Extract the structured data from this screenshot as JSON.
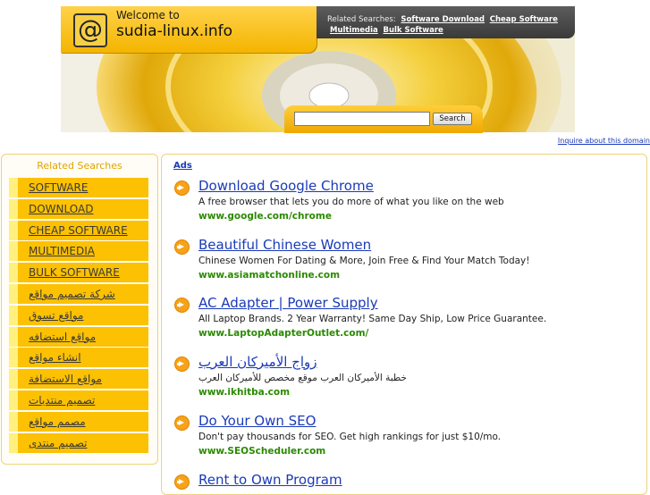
{
  "header": {
    "welcome": "Welcome to",
    "site_name": "sudia-linux.info",
    "related_label": "Related Searches:",
    "related_links": [
      "Software Download",
      "Cheap Software",
      "Multimedia",
      "Bulk Software"
    ],
    "search_button": "Search",
    "search_value": "",
    "inquire": "Inquire about this domain"
  },
  "sidebar": {
    "title": "Related Searches",
    "items": [
      "SOFTWARE",
      "DOWNLOAD",
      "CHEAP SOFTWARE",
      "MULTIMEDIA",
      "BULK SOFTWARE",
      "شركة تصميم مواقع",
      "مواقع تسوق",
      "مواقع استضافه",
      "انشاء مواقع",
      "مواقع الاستضافة",
      "تصميم منتديات",
      "مصمم مواقع",
      "تصميم منتدى"
    ]
  },
  "main": {
    "ads_label": "Ads",
    "ads": [
      {
        "title": "Download Google Chrome",
        "desc": "A free browser that lets you do more of what you like on the web",
        "url": "www.google.com/chrome"
      },
      {
        "title": "Beautiful Chinese Women",
        "desc": "Chinese Women For Dating & More, Join Free & Find Your Match Today!",
        "url": "www.asiamatchonline.com"
      },
      {
        "title": "AC Adapter | Power Supply",
        "desc": "All Laptop Brands. 2 Year Warranty! Same Day Ship, Low Price Guarantee.",
        "url": "www.LaptopAdapterOutlet.com/"
      },
      {
        "title": "زواج الأميركان العرب",
        "desc": "خطبة الأميركان العرب موقع مخصص للأميركان العرب",
        "url": "www.ikhitba.com"
      },
      {
        "title": "Do Your Own SEO",
        "desc": "Don't pay thousands for SEO. Get high rankings for just $10/mo.",
        "url": "www.SEOScheduler.com"
      },
      {
        "title": "Rent to Own Program",
        "desc": "",
        "url": ""
      }
    ]
  },
  "colors": {
    "accent": "#fcc103",
    "link": "#1a3ab8",
    "url_green": "#2a8a00"
  }
}
